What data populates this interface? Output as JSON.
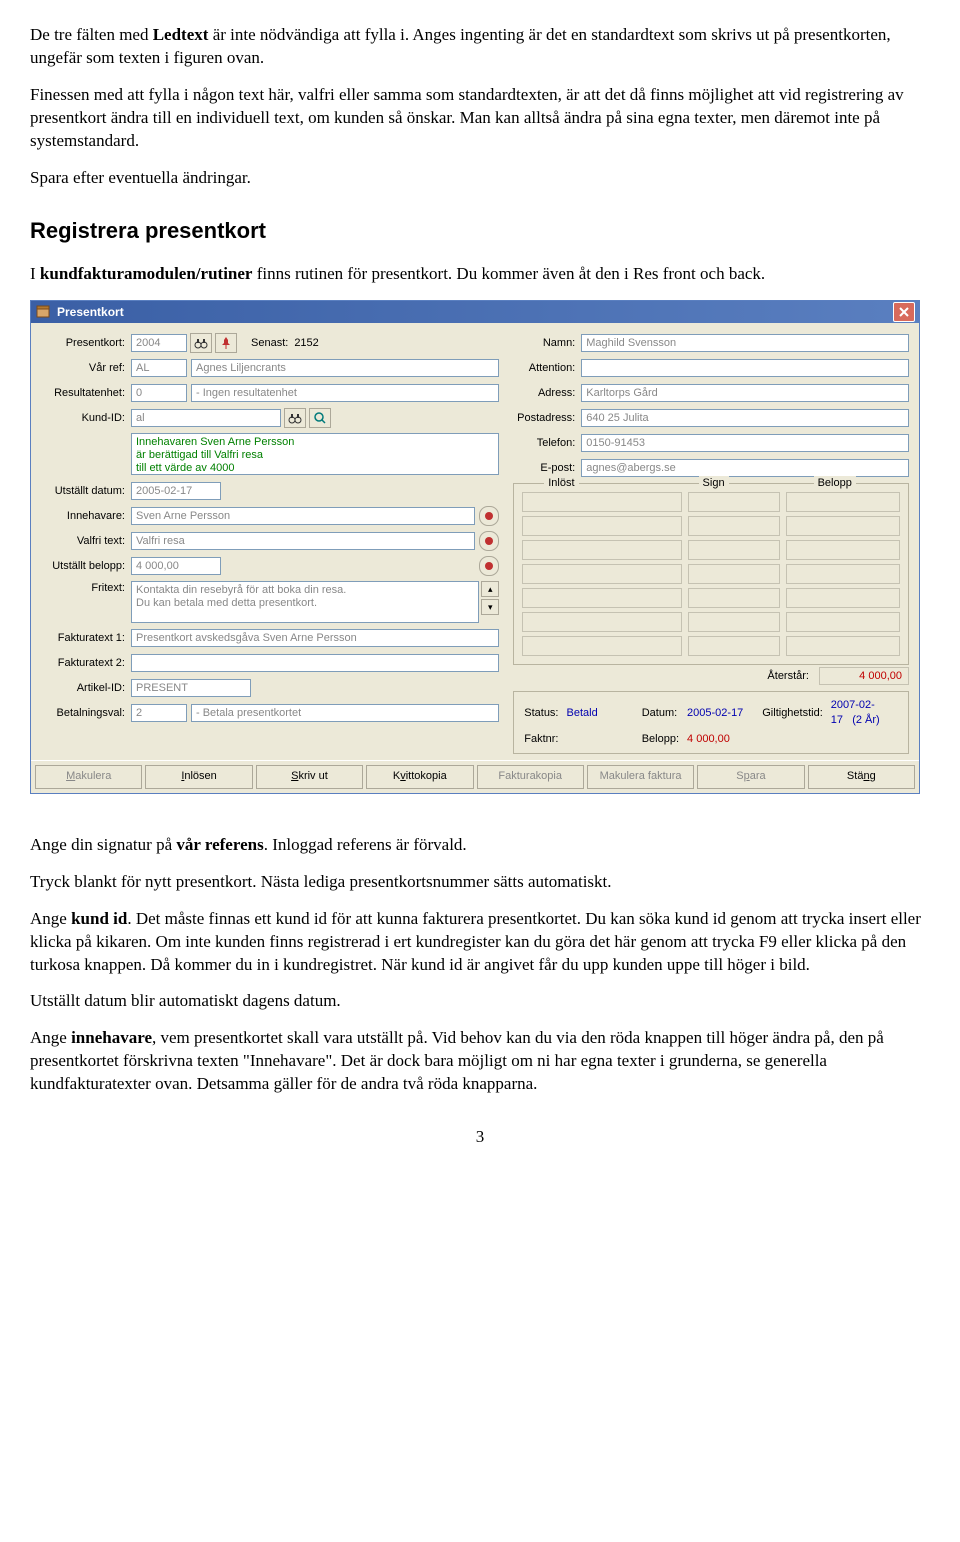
{
  "doc": {
    "p1a": "De tre fälten med ",
    "p1b": "Ledtext",
    "p1c": " är inte nödvändiga att fylla i. Anges ingenting är det en standardtext som skrivs ut på presentkorten, ungefär som texten i figuren ovan.",
    "p2": "Finessen med att fylla i någon text här, valfri eller samma som standardtexten, är att det då finns möjlighet att vid registrering av presentkort ändra till en individuell text, om kunden så önskar. Man kan alltså ändra på sina egna texter, men däremot inte på systemstandard.",
    "p3": "Spara efter eventuella ändringar.",
    "h2": "Registrera presentkort",
    "p4a": " I ",
    "p4b": "kundfakturamodulen/rutiner",
    "p4c": " finns rutinen för presentkort. Du kommer även åt den i Res front och back.",
    "p5a": "Ange din signatur på ",
    "p5b": "vår referens",
    "p5c": ". Inloggad referens är förvald.",
    "p6": "Tryck blankt för nytt presentkort. Nästa lediga presentkortsnummer sätts automatiskt.",
    "p7a": "Ange ",
    "p7b": "kund id",
    "p7c": ". Det måste finnas ett kund id för att kunna fakturera presentkortet. Du kan söka kund id genom att trycka insert eller klicka på kikaren. Om inte kunden finns registrerad i ert kundregister kan du göra det här genom att trycka F9 eller klicka på den turkosa knappen. Då kommer du in i kundregistret. När kund id är angivet får du upp kunden uppe till höger i bild.",
    "p8": "Utställt datum blir automatiskt dagens datum.",
    "p9a": "Ange ",
    "p9b": "innehavare",
    "p9c": ", vem presentkortet skall vara utställt på. Vid behov kan du via den röda knappen till höger ändra på, den på presentkortet förskrivna texten \"Innehavare\". Det är dock bara möjligt om ni har egna texter i grunderna, se generella kundfakturatexter ovan. Detsamma gäller för de andra två röda knapparna.",
    "pagenum": "3"
  },
  "dlg": {
    "title": "Presentkort",
    "labels": {
      "presentkort": "Presentkort:",
      "senast": "Senast:",
      "varref": "Vår ref:",
      "resultatenhet": "Resultatenhet:",
      "kundid": "Kund-ID:",
      "utstallt": "Utställt datum:",
      "innehavare": "Innehavare:",
      "valfritext": "Valfri text:",
      "utstalltbelopp": "Utställt belopp:",
      "fritext": "Fritext:",
      "fakturatext1": "Fakturatext 1:",
      "fakturatext2": "Fakturatext 2:",
      "artikelid": "Artikel-ID:",
      "betalningsval": "Betalningsval:",
      "namn": "Namn:",
      "attention": "Attention:",
      "adress": "Adress:",
      "postadress": "Postadress:",
      "telefon": "Telefon:",
      "epost": "E-post:",
      "inlost": "Inlöst",
      "sign": "Sign",
      "belopp_col": "Belopp",
      "aterstar": "Återstår:",
      "status": "Status:",
      "faktnr": "Faktnr:",
      "datum": "Datum:",
      "belopp": "Belopp:",
      "giltighetstid": "Giltighetstid:"
    },
    "values": {
      "presentkort": "2004",
      "senast": "2152",
      "varref_sign": "AL",
      "varref_name": "Agnes Liljencrants",
      "resultatenhet": "0",
      "resultatenhet_txt": "- Ingen resultatenhet",
      "kundid": "al",
      "memo1": "Innehavaren Sven Arne Persson",
      "memo2": "är berättigad till Valfri resa",
      "memo3": "till ett värde av 4000",
      "utstallt": "2005-02-17",
      "innehavare": "Sven Arne Persson",
      "valfritext": "Valfri resa",
      "utstalltbelopp": "4 000,00",
      "fritext1": "Kontakta din resebyrå för att boka din resa.",
      "fritext2": "Du kan betala med detta presentkort.",
      "fakturatext1": "Presentkort avskedsgåva Sven Arne Persson",
      "fakturatext2": "",
      "artikelid": "PRESENT",
      "betalningsval": "2",
      "betalningsval_txt": "- Betala presentkortet",
      "namn": "Maghild Svensson",
      "attention": "",
      "adress": "Karltorps Gård",
      "postadress": "640 25 Julita",
      "telefon": "0150-91453",
      "epost": "agnes@abergs.se",
      "aterstar": "4 000,00",
      "status": "Betald",
      "faktnr": "",
      "datum": "2005-02-17",
      "belopp": "4 000,00",
      "giltighetstid": "2007-02-17",
      "giltighet_suffix": "(2 År)"
    },
    "buttons": {
      "makulera": "Makulera",
      "inlosen": "Inlösen",
      "skrivut": "Skriv ut",
      "kvittokopia": "Kvittokopia",
      "fakturakopia": "Fakturakopia",
      "makulerafaktura": "Makulera faktura",
      "spara": "Spara",
      "stang": "Stäng"
    }
  }
}
